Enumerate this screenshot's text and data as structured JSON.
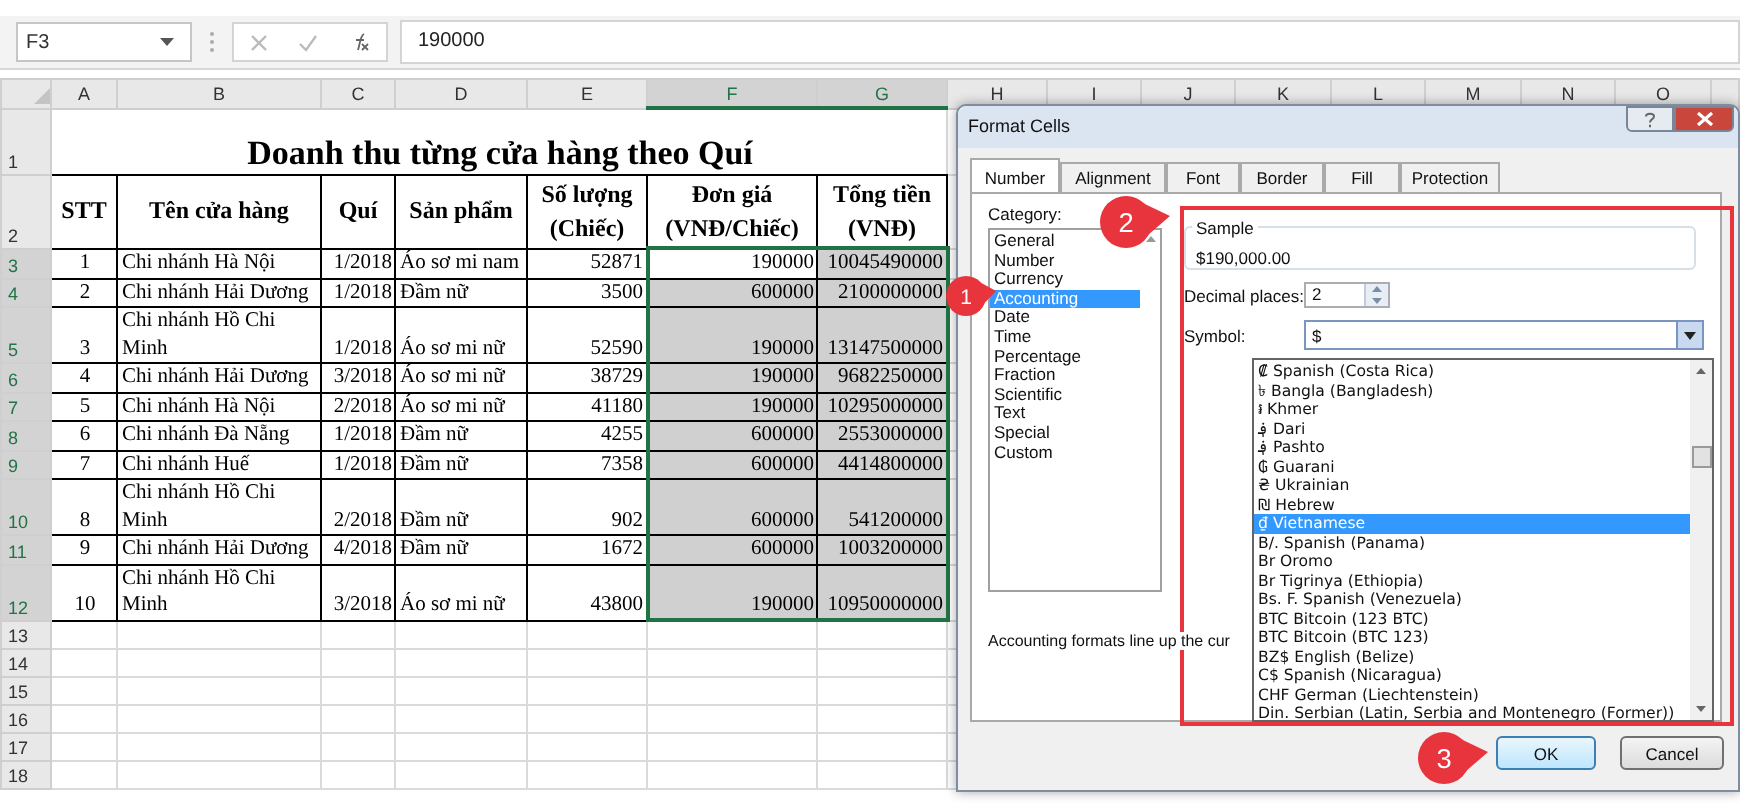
{
  "formula_bar": {
    "name_box": "F3",
    "value": "190000"
  },
  "columns": [
    {
      "label": "A",
      "selected": false
    },
    {
      "label": "B",
      "selected": false
    },
    {
      "label": "C",
      "selected": false
    },
    {
      "label": "D",
      "selected": false
    },
    {
      "label": "E",
      "selected": false
    },
    {
      "label": "F",
      "selected": true
    },
    {
      "label": "G",
      "selected": true
    },
    {
      "label": "H",
      "selected": false
    },
    {
      "label": "I",
      "selected": false
    },
    {
      "label": "J",
      "selected": false
    },
    {
      "label": "K",
      "selected": false
    },
    {
      "label": "L",
      "selected": false
    },
    {
      "label": "M",
      "selected": false
    },
    {
      "label": "N",
      "selected": false
    },
    {
      "label": "O",
      "selected": false
    }
  ],
  "row_headers": [
    {
      "label": "1",
      "selected": false
    },
    {
      "label": "2",
      "selected": false
    },
    {
      "label": "3",
      "selected": true
    },
    {
      "label": "4",
      "selected": true
    },
    {
      "label": "5",
      "selected": true
    },
    {
      "label": "6",
      "selected": true
    },
    {
      "label": "7",
      "selected": true
    },
    {
      "label": "8",
      "selected": true
    },
    {
      "label": "9",
      "selected": true
    },
    {
      "label": "10",
      "selected": true
    },
    {
      "label": "11",
      "selected": true
    },
    {
      "label": "12",
      "selected": true
    },
    {
      "label": "13",
      "selected": false
    },
    {
      "label": "14",
      "selected": false
    },
    {
      "label": "15",
      "selected": false
    },
    {
      "label": "16",
      "selected": false
    },
    {
      "label": "17",
      "selected": false
    },
    {
      "label": "18",
      "selected": false
    }
  ],
  "sheet": {
    "title": "Doanh thu từng cửa hàng theo Quí",
    "headers": [
      "STT",
      "Tên cửa hàng",
      "Quí",
      "Sản phẩm",
      "Số lượng (Chiếc)",
      "Đơn giá (VNĐ/Chiếc)",
      "Tổng tiền (VNĐ)"
    ],
    "rows": [
      {
        "cells": [
          "1",
          "Chi nhánh Hà Nội",
          "1/2018",
          "Áo sơ mi nam",
          "52871",
          "190000",
          "10045490000"
        ],
        "active": true
      },
      {
        "cells": [
          "2",
          "Chi nhánh Hải Dương",
          "1/2018",
          "Đầm nữ",
          "3500",
          "600000",
          "2100000000"
        ],
        "active": false
      },
      {
        "cells": [
          "3",
          "Chi nhánh Hồ Chi Minh",
          "1/2018",
          "Áo sơ mi nữ",
          "52590",
          "190000",
          "13147500000"
        ],
        "active": false
      },
      {
        "cells": [
          "4",
          "Chi nhánh Hải Dương",
          "3/2018",
          "Áo sơ mi nữ",
          "38729",
          "190000",
          "9682250000"
        ],
        "active": false
      },
      {
        "cells": [
          "5",
          "Chi nhánh Hà Nội",
          "2/2018",
          "Áo sơ mi nữ",
          "41180",
          "190000",
          "10295000000"
        ],
        "active": false
      },
      {
        "cells": [
          "6",
          "Chi nhánh Đà Nẵng",
          "1/2018",
          "Đầm nữ",
          "4255",
          "600000",
          "2553000000"
        ],
        "active": false
      },
      {
        "cells": [
          "7",
          "Chi nhánh Huế",
          "1/2018",
          "Đầm nữ",
          "7358",
          "600000",
          "4414800000"
        ],
        "active": false
      },
      {
        "cells": [
          "8",
          "Chi nhánh Hồ Chi Minh",
          "2/2018",
          "Đầm nữ",
          "902",
          "600000",
          "541200000"
        ],
        "active": false
      },
      {
        "cells": [
          "9",
          "Chi nhánh Hải Dương",
          "4/2018",
          "Đầm nữ",
          "1672",
          "600000",
          "1003200000"
        ],
        "active": false
      },
      {
        "cells": [
          "10",
          "Chi nhánh Hồ Chi Minh",
          "3/2018",
          "Áo sơ mi nữ",
          "43800",
          "190000",
          "10950000000"
        ],
        "active": false
      }
    ]
  },
  "dialog": {
    "title": "Format Cells",
    "tabs": [
      {
        "label": "Number",
        "selected": true
      },
      {
        "label": "Alignment",
        "selected": false
      },
      {
        "label": "Font",
        "selected": false
      },
      {
        "label": "Border",
        "selected": false
      },
      {
        "label": "Fill",
        "selected": false
      },
      {
        "label": "Protection",
        "selected": false
      }
    ],
    "category_label": "Category:",
    "categories": [
      {
        "label": "General",
        "selected": false
      },
      {
        "label": "Number",
        "selected": false
      },
      {
        "label": "Currency",
        "selected": false
      },
      {
        "label": "Accounting",
        "selected": true
      },
      {
        "label": "Date",
        "selected": false
      },
      {
        "label": "Time",
        "selected": false
      },
      {
        "label": "Percentage",
        "selected": false
      },
      {
        "label": "Fraction",
        "selected": false
      },
      {
        "label": "Scientific",
        "selected": false
      },
      {
        "label": "Text",
        "selected": false
      },
      {
        "label": "Special",
        "selected": false
      },
      {
        "label": "Custom",
        "selected": false
      }
    ],
    "sample_label": "Sample",
    "sample": "$190,000.00",
    "decimal_label": "Decimal places:",
    "decimal_value": "2",
    "symbol_label": "Symbol:",
    "symbol_value": "$",
    "symbol_options": [
      {
        "label": "₡ Spanish (Costa Rica)",
        "selected": false
      },
      {
        "label": "৳ Bangla (Bangladesh)",
        "selected": false
      },
      {
        "label": "៛ Khmer",
        "selected": false
      },
      {
        "label": "؋ Dari",
        "selected": false
      },
      {
        "label": "؋ Pashto",
        "selected": false
      },
      {
        "label": "₲ Guarani",
        "selected": false
      },
      {
        "label": "₴ Ukrainian",
        "selected": false
      },
      {
        "label": "₪ Hebrew",
        "selected": false
      },
      {
        "label": "₫ Vietnamese",
        "selected": true
      },
      {
        "label": "B/. Spanish (Panama)",
        "selected": false
      },
      {
        "label": "Br Oromo",
        "selected": false
      },
      {
        "label": "Br Tigrinya (Ethiopia)",
        "selected": false
      },
      {
        "label": "Bs. F. Spanish (Venezuela)",
        "selected": false
      },
      {
        "label": "BTC Bitcoin (123 BTC)",
        "selected": false
      },
      {
        "label": "BTC Bitcoin (BTC 123)",
        "selected": false
      },
      {
        "label": "BZ$ English (Belize)",
        "selected": false
      },
      {
        "label": "C$ Spanish (Nicaragua)",
        "selected": false
      },
      {
        "label": "CHF German (Liechtenstein)",
        "selected": false
      },
      {
        "label": "Din. Serbian (Latin, Serbia and Montenegro (Former))",
        "selected": false
      }
    ],
    "description": "Accounting formats line up the cur",
    "buttons": [
      {
        "label": "OK",
        "kind": "default"
      },
      {
        "label": "Cancel",
        "kind": "normal"
      }
    ]
  },
  "callouts": [
    {
      "label": "1"
    },
    {
      "label": "2"
    },
    {
      "label": "3"
    }
  ]
}
